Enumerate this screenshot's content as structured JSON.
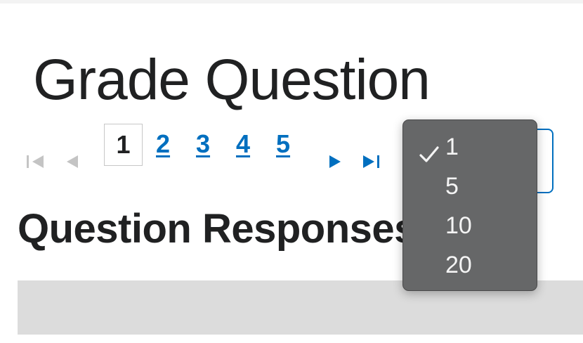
{
  "page": {
    "title": "Grade Question",
    "section_heading": "Question Responses"
  },
  "pager": {
    "current_page": "1",
    "page_links": [
      "2",
      "3",
      "4",
      "5"
    ],
    "icons": {
      "first": "first-page-icon",
      "prev": "previous-page-icon",
      "next": "next-page-icon",
      "last": "last-page-icon"
    }
  },
  "page_size_select": {
    "selected": "1",
    "options": [
      "1",
      "5",
      "10",
      "20"
    ],
    "check_icon": "checkmark-icon"
  },
  "colors": {
    "link": "#006fbf",
    "pager_arrow_disabled": "#c4c4c4",
    "pager_arrow_enabled": "#006fbf",
    "dropdown_bg": "#666768",
    "dropdown_text": "#f4f4f4",
    "table_header_bg": "#dcdcdc"
  }
}
